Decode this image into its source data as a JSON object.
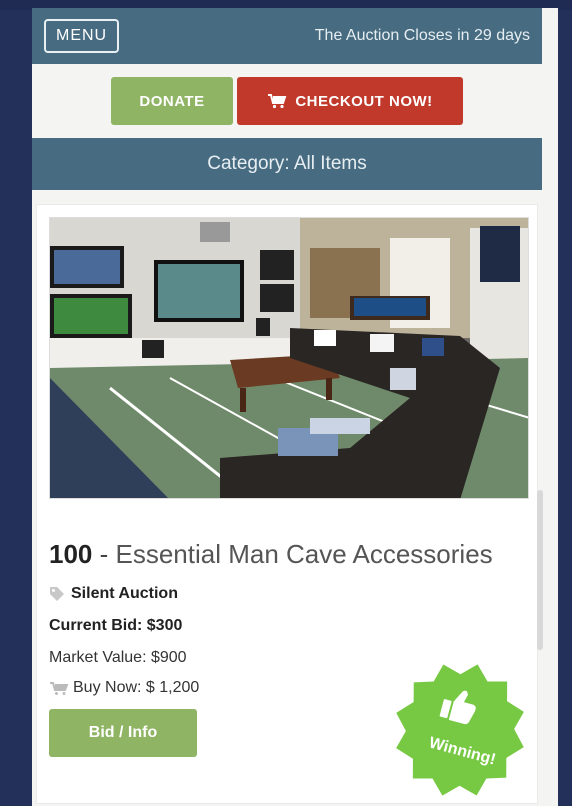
{
  "header": {
    "menu_label": "MENU",
    "auction_status": "The Auction Closes in 29 days"
  },
  "actions": {
    "donate_label": "DONATE",
    "checkout_label": "CHECKOUT NOW!",
    "checkout_icon": "cart-icon"
  },
  "category": {
    "label": "Category: All Items"
  },
  "item": {
    "number": "100",
    "separator": " - ",
    "name": "Essential Man Cave Accessories",
    "auction_type": "Silent Auction",
    "auction_type_icon": "tag-icon",
    "current_bid": "Current Bid: $300",
    "market_value": "Market Value: $900",
    "buy_now": "Buy Now: $ 1,200",
    "buy_now_icon": "cart-icon",
    "bid_button": "Bid / Info",
    "image": {
      "alt": "Man cave room with TVs, sectional sofa, pool table and football field carpet",
      "icon": "photo"
    }
  },
  "badge": {
    "text": "Winning!",
    "icon": "thumbs-up-icon",
    "color": "#77c843"
  },
  "colors": {
    "header": "#476b80",
    "donate": "#8fb463",
    "checkout": "#c0392b",
    "bid": "#8fb463"
  }
}
